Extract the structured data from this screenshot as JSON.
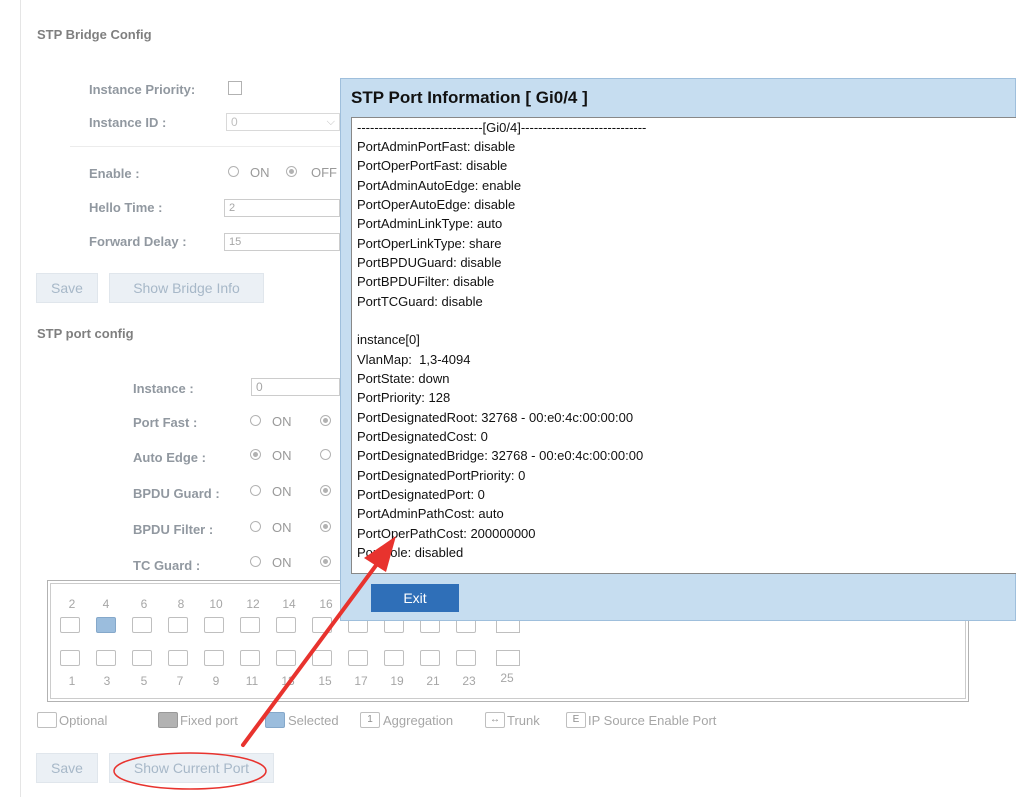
{
  "bridge": {
    "title": "STP Bridge Config",
    "instance_priority_label": "Instance Priority:",
    "instance_id_label": "Instance ID :",
    "instance_id_value": "0",
    "enable_label": "Enable :",
    "on_label": "ON",
    "off_label": "OFF",
    "hello_time_label": "Hello Time :",
    "hello_time_value": "2",
    "forward_delay_label": "Forward Delay :",
    "forward_delay_value": "15",
    "save_label": "Save",
    "show_bridge_label": "Show Bridge Info"
  },
  "port_config": {
    "title": "STP port config",
    "instance_label": "Instance :",
    "instance_value": "0",
    "port_fast_label": "Port Fast :",
    "auto_edge_label": "Auto Edge :",
    "bpdu_guard_label": "BPDU Guard :",
    "bpdu_filter_label": "BPDU Filter :",
    "tc_guard_label": "TC Guard :",
    "on_label": "ON",
    "save_label": "Save",
    "show_current_label": "Show Current Port"
  },
  "ports": {
    "top_numbers": [
      "2",
      "4",
      "6",
      "8",
      "10",
      "12",
      "14",
      "16"
    ],
    "bottom_numbers": [
      "1",
      "3",
      "5",
      "7",
      "9",
      "11",
      "13",
      "15",
      "17",
      "19",
      "21",
      "23",
      "25"
    ],
    "selected_port": "4"
  },
  "legend": {
    "optional": "Optional",
    "fixed": "Fixed port",
    "selected": "Selected",
    "aggregation_icon": "1",
    "aggregation": "Aggregation",
    "trunk_icon": "↔",
    "trunk": "Trunk",
    "ipsource_icon": "E",
    "ipsource": "IP Source Enable Port"
  },
  "dialog": {
    "title": "STP Port Information [ Gi0/4 ]",
    "lines": [
      "-----------------------------[Gi0/4]-----------------------------",
      "PortAdminPortFast: disable",
      "PortOperPortFast: disable",
      "PortAdminAutoEdge: enable",
      "PortOperAutoEdge: disable",
      "PortAdminLinkType: auto",
      "PortOperLinkType: share",
      "PortBPDUGuard: disable",
      "PortBPDUFilter: disable",
      "PortTCGuard: disable",
      "",
      "instance[0]",
      "VlanMap:  1,3-4094",
      "PortState: down",
      "PortPriority: 128",
      "PortDesignatedRoot: 32768 - 00:e0:4c:00:00:00",
      "PortDesignatedCost: 0",
      "PortDesignatedBridge: 32768 - 00:e0:4c:00:00:00",
      "PortDesignatedPortPriority: 0",
      "PortDesignatedPort: 0",
      "PortAdminPathCost: auto",
      "PortOperPathCost: 200000000",
      "PortRole: disabled"
    ],
    "exit_label": "Exit"
  },
  "colors": {
    "dialog_bg": "#c6ddf0",
    "exit_button": "#2f6fb8",
    "annotation_red": "#e8332e",
    "selected_port": "#7aa7d2"
  }
}
